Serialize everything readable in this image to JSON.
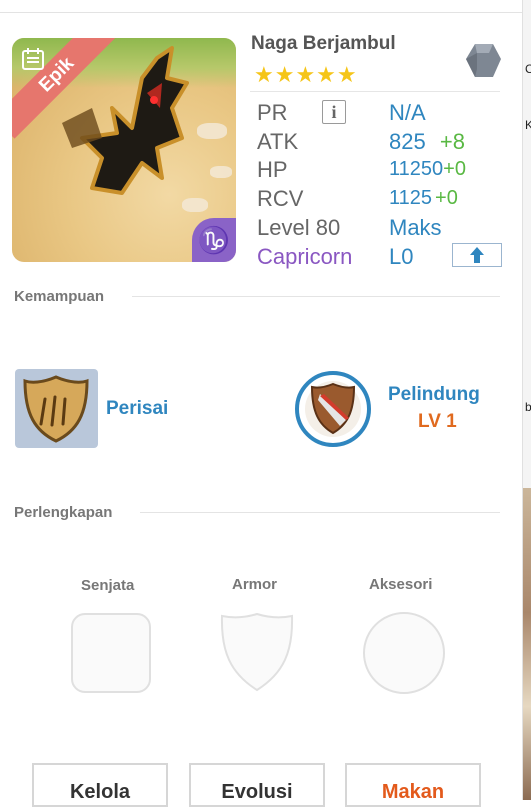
{
  "monster": {
    "rarity": "Epik",
    "name": "Naga Berjambul",
    "stars": "★★★★★",
    "element_icon": "stone-hexagon-icon",
    "zodiac_badge": "♑"
  },
  "stats": {
    "pr": {
      "label": "PR",
      "value": "N/A",
      "info_icon": "i"
    },
    "atk": {
      "label": "ATK",
      "value": "825",
      "bonus": "+8"
    },
    "hp": {
      "label": "HP",
      "value": "11250",
      "bonus": "+0"
    },
    "rcv": {
      "label": "RCV",
      "value": "1125",
      "bonus": "+0"
    },
    "level": {
      "label": "Level 80",
      "value": "Maks"
    },
    "zodiac": {
      "label": "Capricorn",
      "value": "L0"
    }
  },
  "abilities": {
    "title": "Kemampuan",
    "items": [
      {
        "label": "Perisai",
        "icon": "shield-claw-icon"
      },
      {
        "label": "Pelindung",
        "level": "LV 1",
        "icon": "defender-badge-icon"
      }
    ]
  },
  "equipment": {
    "title": "Perlengkapan",
    "slots": [
      {
        "label": "Senjata"
      },
      {
        "label": "Armor"
      },
      {
        "label": "Aksesori"
      }
    ]
  },
  "buttons": {
    "manage": "Kelola",
    "evolve": "Evolusi",
    "eat": "Makan"
  },
  "edge_glyphs": [
    "C",
    "K",
    "b"
  ]
}
